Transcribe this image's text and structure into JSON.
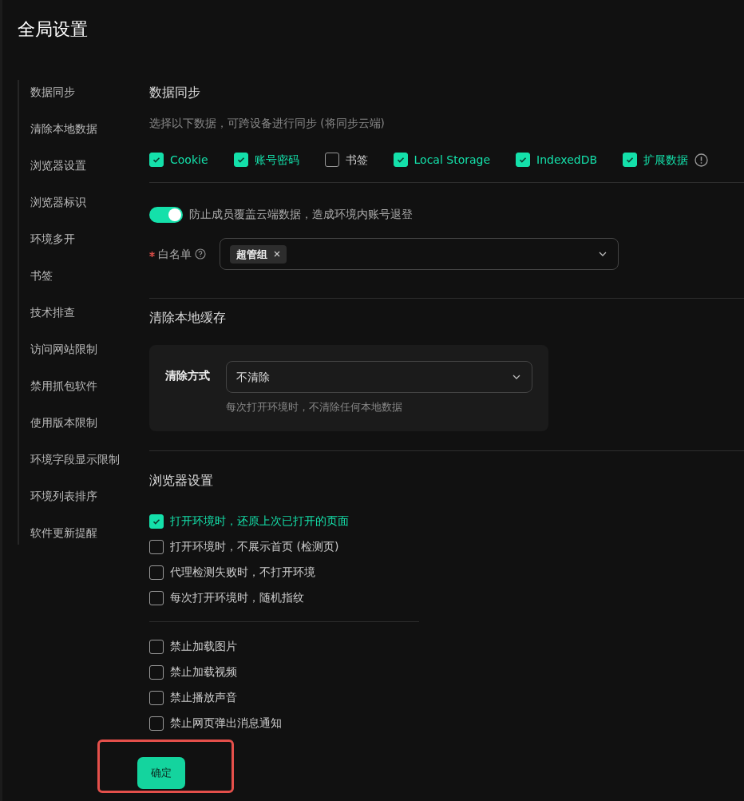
{
  "title": "全局设置",
  "sidebar": {
    "items": [
      "数据同步",
      "清除本地数据",
      "浏览器设置",
      "浏览器标识",
      "环境多开",
      "书签",
      "技术排查",
      "访问网站限制",
      "禁用抓包软件",
      "使用版本限制",
      "环境字段显示限制",
      "环境列表排序",
      "软件更新提醒"
    ]
  },
  "data_sync": {
    "heading": "数据同步",
    "description": "选择以下数据，可跨设备进行同步 (将同步云端)",
    "options": [
      {
        "label": "Cookie",
        "checked": true,
        "info": false
      },
      {
        "label": "账号密码",
        "checked": true,
        "info": false
      },
      {
        "label": "书签",
        "checked": false,
        "info": false
      },
      {
        "label": "Local Storage",
        "checked": true,
        "info": false
      },
      {
        "label": "IndexedDB",
        "checked": true,
        "info": false
      },
      {
        "label": "扩展数据",
        "checked": true,
        "info": true
      }
    ],
    "protect_toggle": {
      "label": "防止成员覆盖云端数据，造成环境内账号退登",
      "on": true
    },
    "whitelist": {
      "label": "白名单",
      "required": true,
      "tags": [
        "超管组"
      ]
    }
  },
  "clear_cache": {
    "heading": "清除本地缓存",
    "method_label": "清除方式",
    "method_value": "不清除",
    "hint": "每次打开环境时，不清除任何本地数据"
  },
  "browser_settings": {
    "heading": "浏览器设置",
    "groups": [
      [
        {
          "label": "打开环境时，还原上次已打开的页面",
          "checked": true
        },
        {
          "label": "打开环境时，不展示首页 (检测页)",
          "checked": false
        },
        {
          "label": "代理检测失败时，不打开环境",
          "checked": false
        },
        {
          "label": "每次打开环境时，随机指纹",
          "checked": false
        }
      ],
      [
        {
          "label": "禁止加载图片",
          "checked": false
        },
        {
          "label": "禁止加载视频",
          "checked": false
        },
        {
          "label": "禁止播放声音",
          "checked": false
        },
        {
          "label": "禁止网页弹出消息通知",
          "checked": false
        }
      ]
    ]
  },
  "confirm_button": {
    "label": "确定",
    "highlighted": true
  }
}
